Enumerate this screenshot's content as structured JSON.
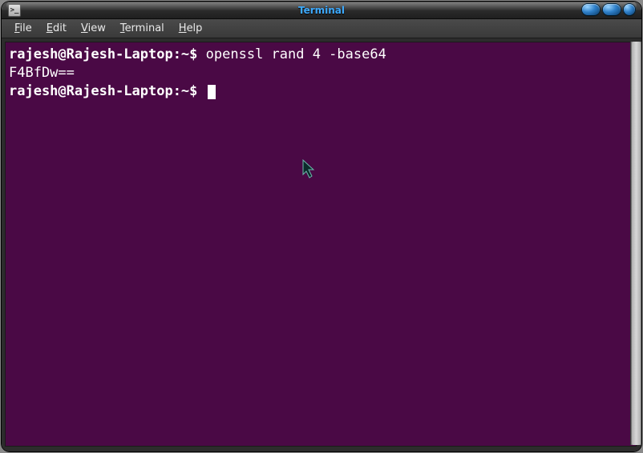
{
  "titlebar": {
    "title": "Terminal",
    "icon_glyph": ">_"
  },
  "menubar": {
    "items": [
      {
        "label": "File",
        "accel_index": 0
      },
      {
        "label": "Edit",
        "accel_index": 0
      },
      {
        "label": "View",
        "accel_index": 0
      },
      {
        "label": "Terminal",
        "accel_index": 0
      },
      {
        "label": "Help",
        "accel_index": 0
      }
    ]
  },
  "terminal": {
    "prompt": "rajesh@Rajesh-Laptop:~$",
    "history": [
      {
        "prompt": "rajesh@Rajesh-Laptop:~$",
        "command": "openssl rand 4 -base64"
      },
      {
        "output": "F4BfDw=="
      }
    ],
    "current_command": "",
    "colors": {
      "bg": "#4a0945",
      "fg": "#ffffff"
    }
  }
}
